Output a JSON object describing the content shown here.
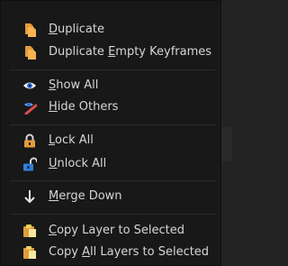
{
  "menu": {
    "items": [
      {
        "id": "duplicate",
        "label": "Duplicate",
        "mnemonic_index": 0,
        "icon": "duplicate-icon"
      },
      {
        "id": "duplicate-empty",
        "label": "Duplicate Empty Keyframes",
        "mnemonic_index": 10,
        "icon": "duplicate-icon"
      },
      {
        "id": "show-all",
        "label": "Show All",
        "mnemonic_index": 0,
        "icon": "eye-icon"
      },
      {
        "id": "hide-others",
        "label": "Hide Others",
        "mnemonic_index": 0,
        "icon": "hide-icon"
      },
      {
        "id": "lock-all",
        "label": "Lock All",
        "mnemonic_index": 0,
        "icon": "lock-icon"
      },
      {
        "id": "unlock-all",
        "label": "Unlock All",
        "mnemonic_index": 0,
        "icon": "unlock-icon"
      },
      {
        "id": "merge-down",
        "label": "Merge Down",
        "mnemonic_index": 0,
        "icon": "arrow-down-icon"
      },
      {
        "id": "copy-layer",
        "label": "Copy Layer to Selected",
        "mnemonic_index": 0,
        "icon": "paste-icon"
      },
      {
        "id": "copy-all-layers",
        "label": "Copy All Layers to Selected",
        "mnemonic_index": 5,
        "icon": "paste-icon"
      }
    ]
  },
  "colors": {
    "menu_bg": "#181818",
    "text": "#d6d6d6",
    "icon_orange": "#e39b3c",
    "icon_yellow": "#f0d060"
  }
}
